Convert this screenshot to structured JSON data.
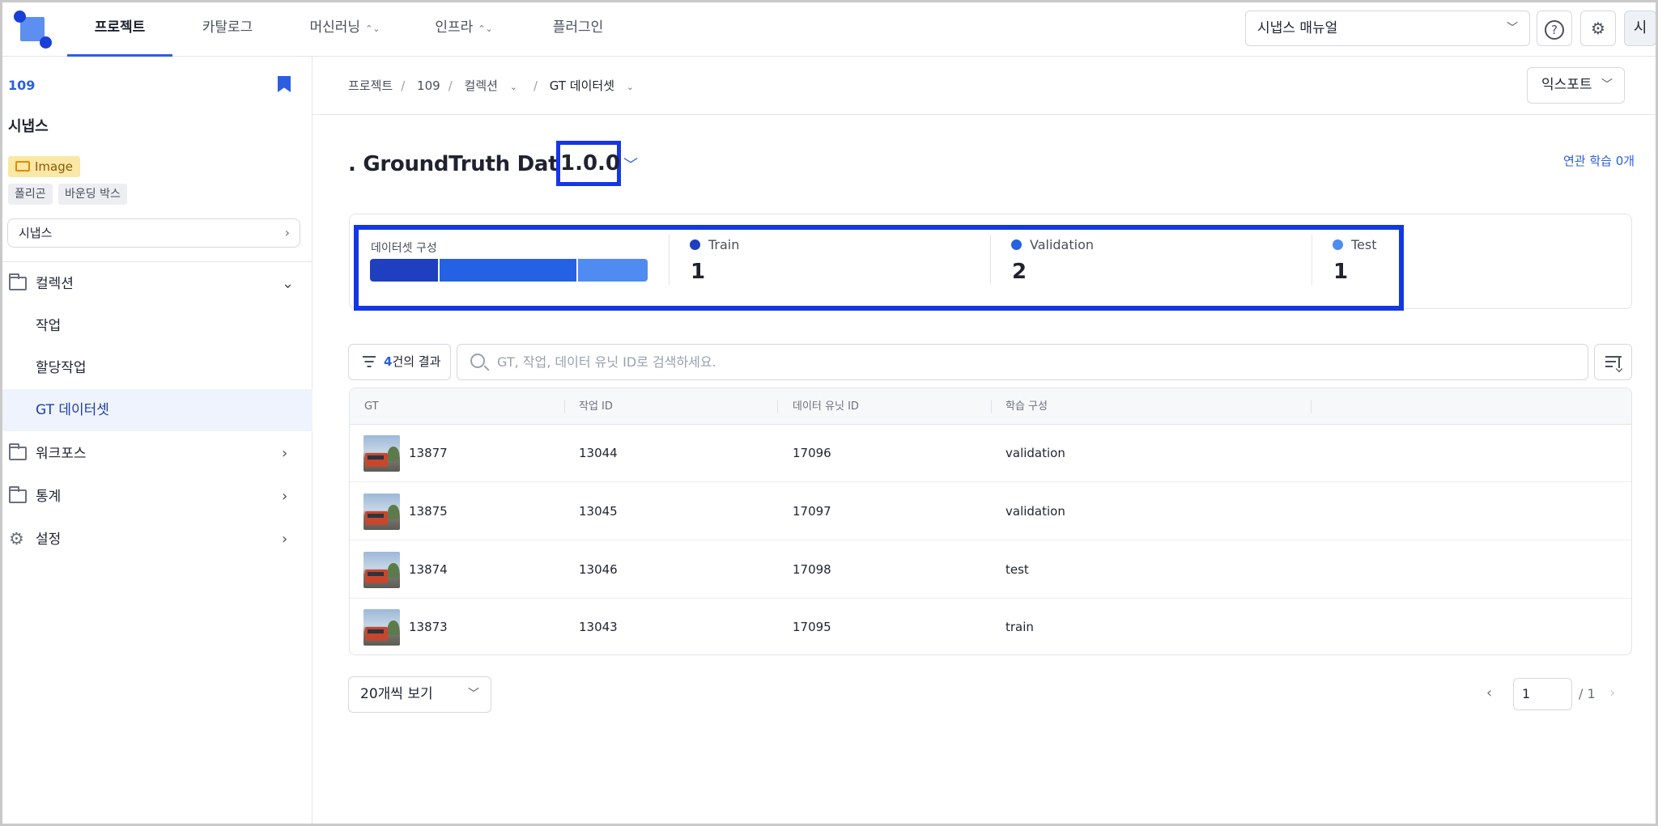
{
  "nav": {
    "tabs": [
      {
        "label": "프로젝트",
        "active": true
      },
      {
        "label": "카탈로그",
        "active": false
      },
      {
        "label": "머신러닝",
        "active": false
      },
      {
        "label": "인프라",
        "active": false
      },
      {
        "label": "플러그인",
        "active": false
      }
    ],
    "manual_select": "시냅스 매뉴얼",
    "avatar": "시",
    "icons": [
      "help-icon",
      "gear-icon"
    ]
  },
  "sidebar": {
    "project_id": "109",
    "project_name": "시냅스",
    "image_badge": "Image",
    "tags": [
      "폴리곤",
      "바운딩 박스"
    ],
    "project_select": "시냅스",
    "collection": {
      "label": "컬렉션",
      "children": [
        "작업",
        "할당작업",
        "GT 데이터셋"
      ]
    },
    "workforce": "워크포스",
    "stats": "통계",
    "settings": "설정"
  },
  "breadcrumb": {
    "items": [
      "프로젝트",
      "109",
      "컬렉션",
      "GT 데이터셋"
    ],
    "separator": "/"
  },
  "export_label": "익스포트",
  "dataset": {
    "title": ". GroundTruth Dataset",
    "version": "1.0.0",
    "related_link": "연관 학습 0개"
  },
  "composition": {
    "label": "데이터셋 구성",
    "splits": [
      {
        "name": "Train",
        "count": "1",
        "value": 1,
        "color": "#1e3fbf"
      },
      {
        "name": "Validation",
        "count": "2",
        "value": 2,
        "color": "#2561e3"
      },
      {
        "name": "Test",
        "count": "1",
        "value": 1,
        "color": "#4f8bf0"
      }
    ]
  },
  "toolbar": {
    "result_count": "4",
    "result_suffix": "건의 결과",
    "search_placeholder": "GT, 작업, 데이터 유닛 ID로 검색하세요."
  },
  "table": {
    "headers": [
      "GT",
      "작업 ID",
      "데이터 유닛 ID",
      "학습 구성"
    ],
    "rows": [
      {
        "gt": "13877",
        "task_id": "13044",
        "data_unit_id": "17096",
        "split": "validation"
      },
      {
        "gt": "13875",
        "task_id": "13045",
        "data_unit_id": "17097",
        "split": "validation"
      },
      {
        "gt": "13874",
        "task_id": "13046",
        "data_unit_id": "17098",
        "split": "test"
      },
      {
        "gt": "13873",
        "task_id": "13043",
        "data_unit_id": "17095",
        "split": "train"
      }
    ]
  },
  "pagination": {
    "page_size_label": "20개씩 보기",
    "current_page": "1",
    "total": "/ 1"
  }
}
